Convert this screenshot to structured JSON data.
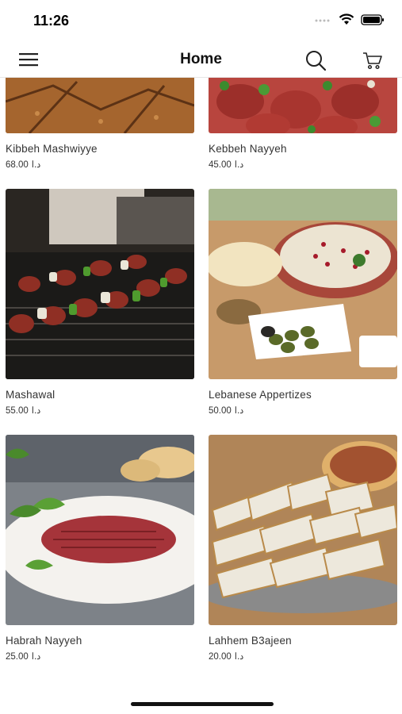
{
  "status": {
    "time": "11:26"
  },
  "nav": {
    "title": "Home"
  },
  "icons": {
    "menu": "hamburger-icon",
    "search": "search-icon",
    "cart": "cart-icon"
  },
  "products": [
    {
      "name": "Kibbeh Mashwiyye",
      "price": "68.00",
      "currency": "د.ا"
    },
    {
      "name": "Kebbeh Nayyeh",
      "price": "45.00",
      "currency": "د.ا"
    },
    {
      "name": "Mashawal",
      "price": "55.00",
      "currency": "د.ا"
    },
    {
      "name": "Lebanese Appertizes",
      "price": "50.00",
      "currency": "د.ا"
    },
    {
      "name": "Habrah Nayyeh",
      "price": "25.00",
      "currency": "د.ا"
    },
    {
      "name": "Lahhem B3ajeen",
      "price": "20.00",
      "currency": "د.ا"
    }
  ]
}
